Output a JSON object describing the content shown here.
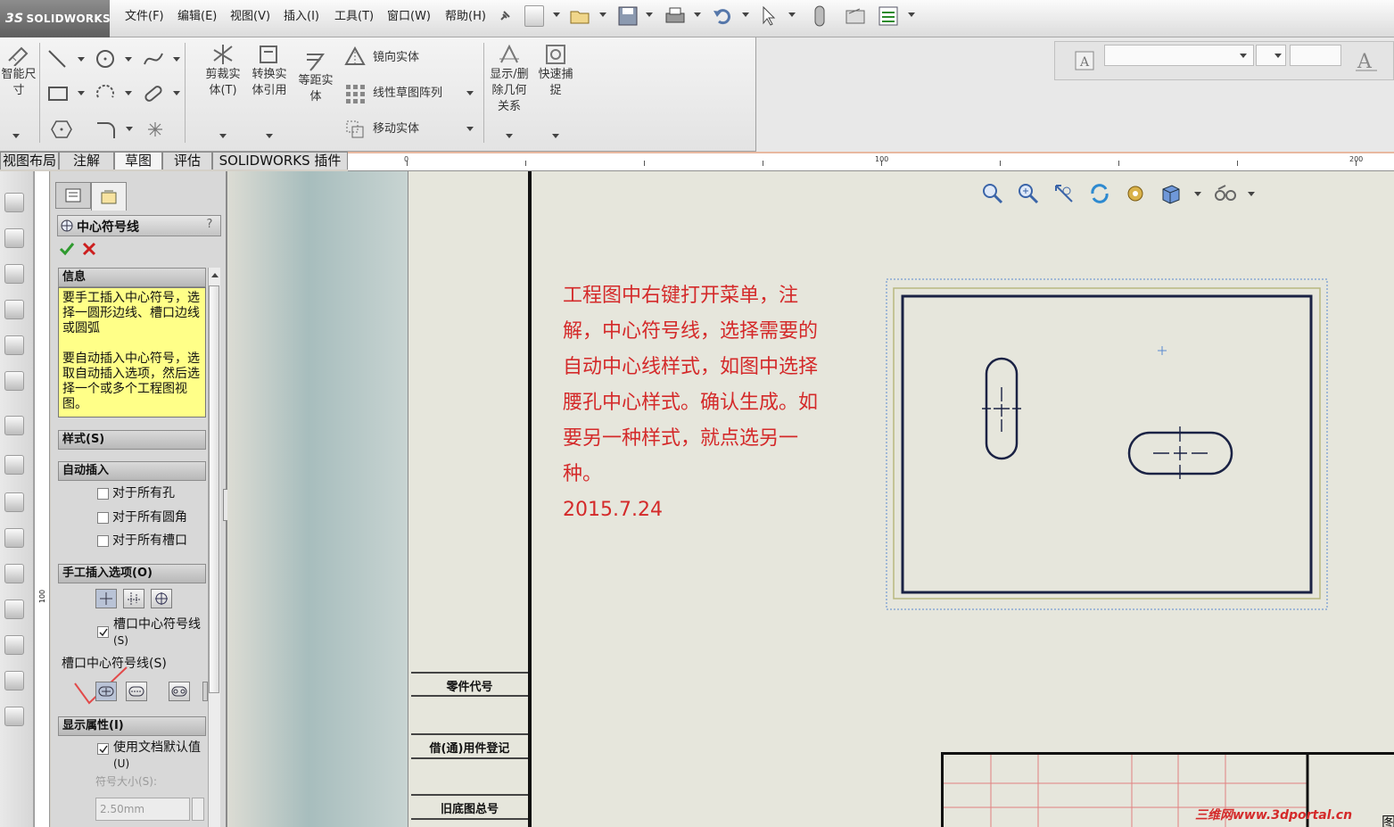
{
  "app": {
    "logo": "SOLIDWORKS",
    "logo_mark": "3S"
  },
  "menu": [
    "文件(F)",
    "编辑(E)",
    "视图(V)",
    "插入(I)",
    "工具(T)",
    "窗口(W)",
    "帮助(H)"
  ],
  "ribbon": {
    "smart_dim": "智能尺寸",
    "trim": "剪裁实体(T)",
    "convert": "转换实体引用",
    "offset": "等距实体",
    "mirror": "镜向实体",
    "linear_pattern": "线性草图阵列",
    "move": "移动实体",
    "relations": "显示/删除几何关系",
    "quick_snap": "快速捕捉"
  },
  "tabs": [
    "视图布局",
    "注解",
    "草图",
    "评估",
    "SOLIDWORKS 插件"
  ],
  "ruler": {
    "h_labels": [
      "0",
      "100",
      "200"
    ],
    "v_label": "100"
  },
  "pm": {
    "title": "中心符号线",
    "help": "?",
    "info_header": "信息",
    "info_text1": "要手工插入中心符号，选择一圆形边线、槽口边线或圆弧",
    "info_text2": "要自动插入中心符号，选取自动插入选项，然后选择一个或多个工程图视图。",
    "style_header": "样式(S)",
    "auto_header": "自动插入",
    "auto_options": [
      "对于所有孔",
      "对于所有圆角",
      "对于所有槽口"
    ],
    "manual_header": "手工插入选项(O)",
    "slot_cb": "槽口中心符号线",
    "slot_cb_key": "(S)",
    "slot_label": "槽口中心符号线(S)",
    "display_header": "显示属性(I)",
    "use_default": "使用文档默认值",
    "use_default_key": "(U)",
    "symbol_size": "符号大小(S):",
    "size_value": "2.50mm"
  },
  "sheet": {
    "labels": [
      "零件代号",
      "借(通)用件登记",
      "旧底图总号"
    ],
    "note_lines": [
      "工程图中右键打开菜单，注",
      "解，中心符号线，选择需要的",
      "自动中心线样式，如图中选择",
      "腰孔中心样式。确认生成。如",
      "要另一种样式，就点选另一",
      "种。"
    ],
    "note_date": "2015.7.24",
    "corner_char": "图"
  },
  "watermark": "三维网www.3dportal.cn",
  "colors": {
    "accent_red": "#d42a2a",
    "info_bg": "#ffff88",
    "sheet_bg": "#e6e6dc"
  }
}
